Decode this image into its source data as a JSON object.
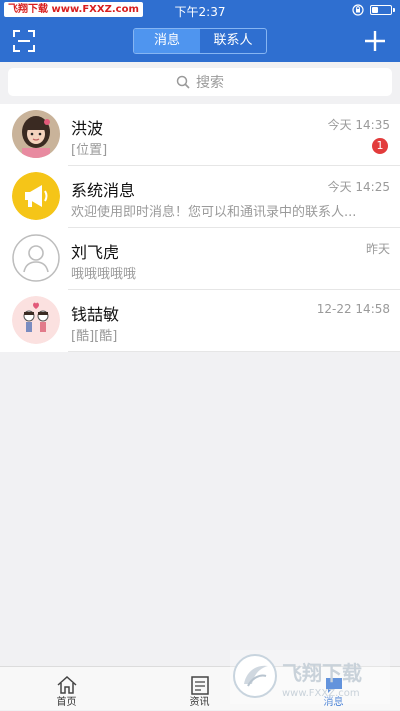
{
  "status": {
    "watermark": "飞翔下载 www.FXXZ.com",
    "time": "下午2:37",
    "battery_level": 0.35
  },
  "header": {
    "tabs": [
      {
        "label": "消息",
        "active": true
      },
      {
        "label": "联系人",
        "active": false
      }
    ]
  },
  "search": {
    "placeholder": "搜索"
  },
  "conversations": [
    {
      "name": "洪波",
      "preview": "[位置]",
      "time": "今天 14:35",
      "unread": "1",
      "avatar": "photo-girl"
    },
    {
      "name": "系统消息",
      "preview": "欢迎使用即时消息！您可以和通讯录中的联系人...",
      "time": "今天 14:25",
      "unread": null,
      "avatar": "megaphone"
    },
    {
      "name": "刘飞虎",
      "preview": "哦哦哦哦哦",
      "time": "昨天",
      "unread": null,
      "avatar": "default-person"
    },
    {
      "name": "钱喆敏",
      "preview": "[酷][酷]",
      "time": "12-22 14:58",
      "unread": null,
      "avatar": "cartoon-couple"
    }
  ],
  "tabbar": {
    "items": [
      {
        "label": "首页",
        "icon": "home-icon",
        "active": false
      },
      {
        "label": "资讯",
        "icon": "news-icon",
        "active": false
      },
      {
        "label": "消息",
        "icon": "chat-icon",
        "active": true
      }
    ]
  },
  "overlay_watermark": {
    "text": "飞翔下载",
    "url": "www.FXXZ.com"
  },
  "colors": {
    "brand": "#2f6fd0",
    "badge": "#e23b3b",
    "system_avatar": "#f5c518"
  }
}
